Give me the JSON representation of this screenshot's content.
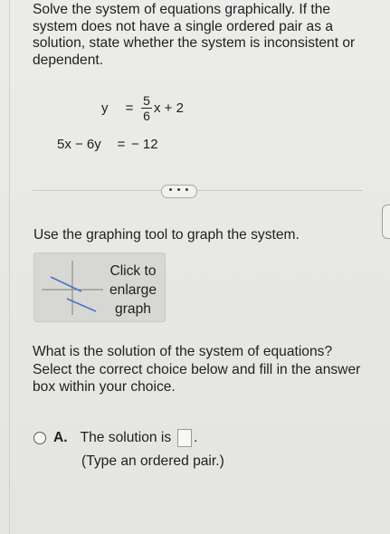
{
  "problem": {
    "text": "Solve the system of equations graphically. If the system does not have a single ordered pair as a solution, state whether the system is inconsistent or dependent."
  },
  "equations": {
    "eq1": {
      "lhs": "y",
      "equals": "=",
      "numerator": "5",
      "denominator": "6",
      "rhs_tail": "x + 2"
    },
    "eq2": {
      "lhs": "5x − 6y",
      "equals": "=",
      "rhs": "− 12"
    }
  },
  "more_button": {
    "label": "• • •"
  },
  "side_handle": {
    "label": "⋮"
  },
  "instruction": "Use the graphing tool to graph the system.",
  "graph_button": {
    "line1": "Click to",
    "line2": "enlarge",
    "line3": "graph"
  },
  "question": {
    "text": "What is the solution of the system of equations? Select the correct choice below and fill in the answer box within your choice."
  },
  "choice_a": {
    "letter": "A.",
    "text": "The solution is",
    "period": ".",
    "hint": "(Type an ordered pair.)"
  },
  "colors": {
    "background": "#e9e9e6",
    "graph_line_1": "#4a76c2",
    "graph_line_2": "#4a76c2"
  }
}
